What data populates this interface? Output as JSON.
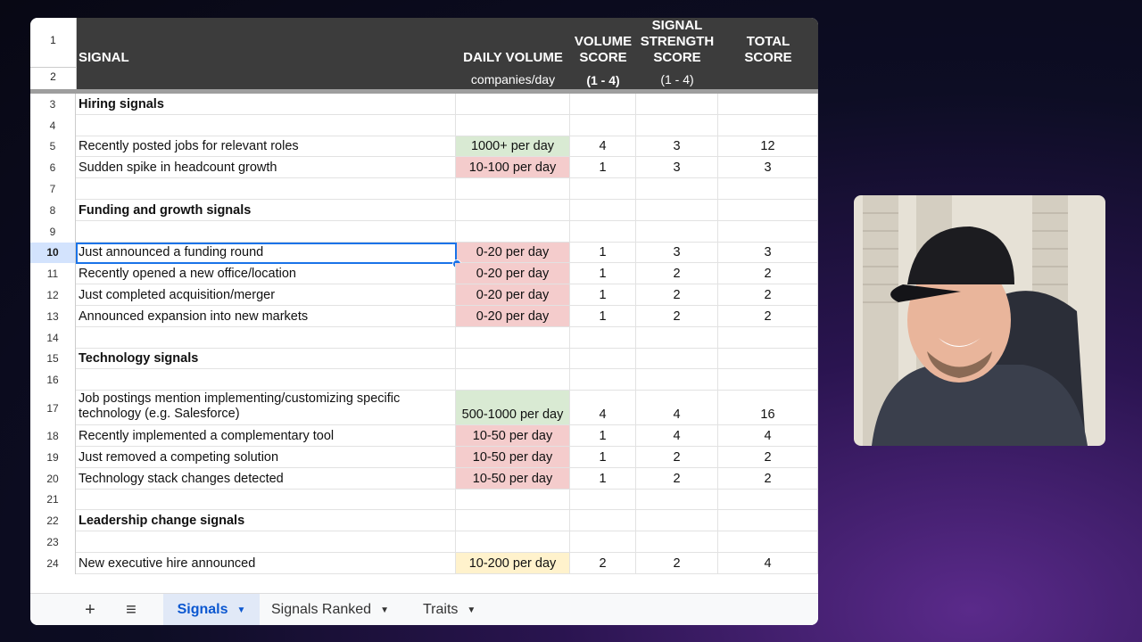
{
  "header": {
    "row1_num": "1",
    "row2_num": "2",
    "signal": "SIGNAL",
    "daily_volume": "DAILY VOLUME",
    "daily_volume_sub": "companies/day",
    "volume_score_l1": "VOLUME",
    "volume_score_l2": "SCORE",
    "volume_score_sub": "(1 - 4)",
    "strength_l1": "SIGNAL",
    "strength_l2": "STRENGTH",
    "strength_l3": "SCORE",
    "strength_sub": "(1 - 4)",
    "total_l1": "TOTAL",
    "total_l2": "SCORE"
  },
  "rows": [
    {
      "num": "3",
      "signal": "Hiring signals",
      "section": true
    },
    {
      "num": "4",
      "signal": ""
    },
    {
      "num": "5",
      "signal": "Recently posted jobs for relevant roles",
      "volume": "1000+ per day",
      "color": "green",
      "vs": "4",
      "ss": "3",
      "ts": "12"
    },
    {
      "num": "6",
      "signal": "Sudden spike in headcount growth",
      "volume": "10-100 per day",
      "color": "red",
      "vs": "1",
      "ss": "3",
      "ts": "3"
    },
    {
      "num": "7",
      "signal": ""
    },
    {
      "num": "8",
      "signal": "Funding and growth signals",
      "section": true
    },
    {
      "num": "9",
      "signal": ""
    },
    {
      "num": "10",
      "signal": "Just announced a funding round",
      "volume": "0-20 per day",
      "color": "red",
      "vs": "1",
      "ss": "3",
      "ts": "3",
      "selected": true
    },
    {
      "num": "11",
      "signal": "Recently opened a new office/location",
      "volume": "0-20 per day",
      "color": "red",
      "vs": "1",
      "ss": "2",
      "ts": "2"
    },
    {
      "num": "12",
      "signal": "Just completed acquisition/merger",
      "volume": "0-20 per day",
      "color": "red",
      "vs": "1",
      "ss": "2",
      "ts": "2"
    },
    {
      "num": "13",
      "signal": "Announced expansion into new markets",
      "volume": "0-20 per day",
      "color": "red",
      "vs": "1",
      "ss": "2",
      "ts": "2"
    },
    {
      "num": "14",
      "signal": ""
    },
    {
      "num": "15",
      "signal": "Technology signals",
      "section": true
    },
    {
      "num": "16",
      "signal": ""
    },
    {
      "num": "17",
      "signal": "Job postings mention implementing/customizing specific technology (e.g. Salesforce)",
      "volume": "500-1000 per day",
      "color": "green",
      "vs": "4",
      "ss": "4",
      "ts": "16",
      "tall": true
    },
    {
      "num": "18",
      "signal": "Recently implemented a complementary tool",
      "volume": "10-50 per day",
      "color": "red",
      "vs": "1",
      "ss": "4",
      "ts": "4"
    },
    {
      "num": "19",
      "signal": "Just removed a competing solution",
      "volume": "10-50 per day",
      "color": "red",
      "vs": "1",
      "ss": "2",
      "ts": "2"
    },
    {
      "num": "20",
      "signal": "Technology stack changes detected",
      "volume": "10-50 per day",
      "color": "red",
      "vs": "1",
      "ss": "2",
      "ts": "2"
    },
    {
      "num": "21",
      "signal": ""
    },
    {
      "num": "22",
      "signal": "Leadership change signals",
      "section": true
    },
    {
      "num": "23",
      "signal": ""
    },
    {
      "num": "24",
      "signal": "New executive hire announced",
      "volume": "10-200 per day",
      "color": "yellow",
      "vs": "2",
      "ss": "2",
      "ts": "4"
    }
  ],
  "tabs": {
    "add_icon": "+",
    "menu_icon": "≡",
    "items": [
      {
        "label": "Signals",
        "active": true
      },
      {
        "label": "Signals Ranked",
        "active": false
      },
      {
        "label": "Traits",
        "active": false
      }
    ]
  },
  "colors": {
    "green": "#d9ead3",
    "red": "#f4cccc",
    "yellow": "#fff2cc",
    "header_bg": "#3c3c3c",
    "selection": "#1a73e8"
  }
}
